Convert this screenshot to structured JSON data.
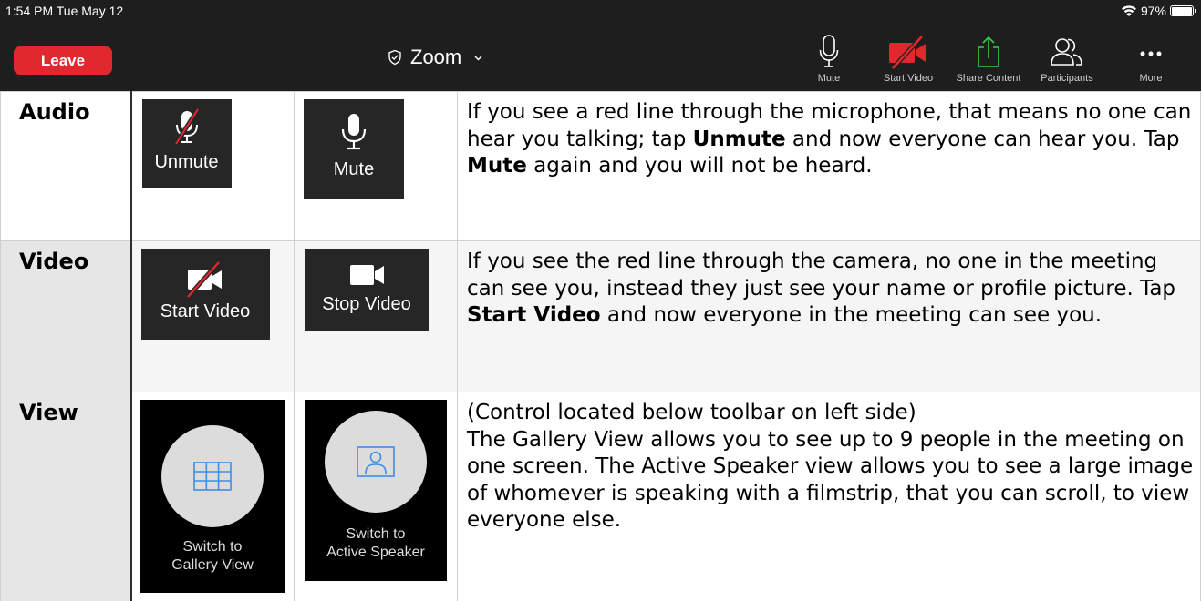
{
  "status_bar": {
    "time": "1:54 PM  Tue May 12",
    "battery": "97%"
  },
  "toolbar": {
    "leave_label": "Leave",
    "meeting_title": "Zoom",
    "items": [
      {
        "label": "Mute",
        "icon": "microphone-icon"
      },
      {
        "label": "Start Video",
        "icon": "video-off-icon"
      },
      {
        "label": "Share Content",
        "icon": "share-icon"
      },
      {
        "label": "Participants",
        "icon": "participants-icon"
      },
      {
        "label": "More",
        "icon": "more-icon"
      }
    ],
    "colors": {
      "leave": "#e0282e",
      "video_off": "#e0282e",
      "share": "#3cc94b",
      "bar": "#1e1e1e"
    }
  },
  "rows": [
    {
      "header": "Audio",
      "controls": [
        "Unmute",
        "Mute"
      ],
      "desc": [
        {
          "t": "If you see a red line through the microphone, that means no one can hear you talking; tap "
        },
        {
          "b": "Unmute"
        },
        {
          "t": " and now everyone can hear you. Tap "
        },
        {
          "b": "Mute"
        },
        {
          "t": " again and you will not be heard."
        }
      ]
    },
    {
      "header": "Video",
      "controls": [
        "Start Video",
        "Stop Video"
      ],
      "desc": [
        {
          "t": "If you see the red line through the camera, no one in the meeting can see you, instead they just see your name or profile picture. Tap "
        },
        {
          "b": "Start Video"
        },
        {
          "t": " and now everyone in the meeting can see you."
        }
      ]
    },
    {
      "header": "View",
      "controls": [
        [
          "Switch to",
          "Gallery View"
        ],
        [
          "Switch to",
          "Active Speaker"
        ]
      ],
      "desc_line1": "(Control located below toolbar on left side)",
      "desc_line2": "The Gallery View allows you to see up to 9 people in the meeting on one screen. The Active Speaker view allows you to see a large image of whomever is speaking with a filmstrip, that you can scroll, to view everyone else."
    }
  ]
}
